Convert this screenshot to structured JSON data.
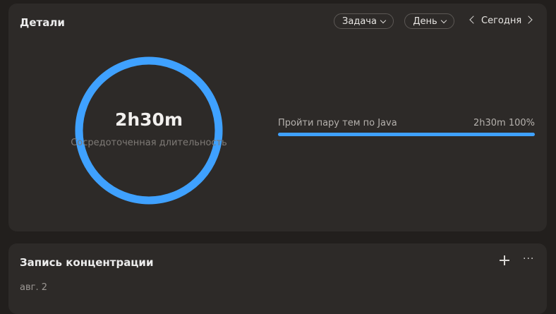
{
  "details": {
    "title": "Детали",
    "filter_task": "Задача",
    "filter_period": "День",
    "date_nav": "Сегодня",
    "ring": {
      "value": "2h30m",
      "caption": "Сосредоточенная длительность",
      "fraction": 1.0,
      "color": "#3fa1ff"
    },
    "tasks": [
      {
        "name": "Пройти пару тем по Java",
        "duration": "2h30m",
        "percent": "100%",
        "fraction": 1.0
      }
    ]
  },
  "record": {
    "title": "Запись концентрации",
    "date": "авг. 2"
  },
  "icons": {
    "prev": "chevron-left-icon",
    "next": "chevron-right-icon",
    "add": "plus-icon",
    "more": "more-horizontal-icon",
    "dropdown": "chevron-down-icon"
  }
}
